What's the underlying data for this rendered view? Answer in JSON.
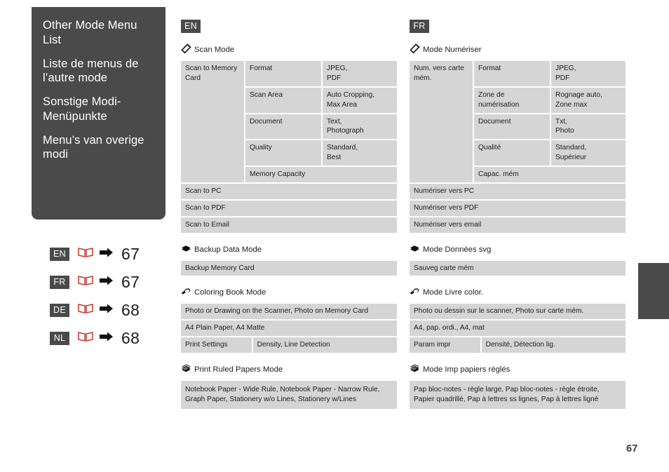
{
  "sidebar": {
    "titles": [
      "Other Mode Menu List",
      "Liste de menus de l’autre mode",
      "Sonstige Modi-Menüpunkte",
      "Menu’s van overige modi"
    ]
  },
  "language_index": {
    "rows": [
      {
        "code": "EN",
        "book_icon": "open-book-icon",
        "arrow_icon": "arrow-right-icon",
        "page": "67"
      },
      {
        "code": "FR",
        "book_icon": "open-book-icon",
        "arrow_icon": "arrow-right-icon",
        "page": "67"
      },
      {
        "code": "DE",
        "book_icon": "open-book-icon",
        "arrow_icon": "arrow-right-icon",
        "page": "68"
      },
      {
        "code": "NL",
        "book_icon": "open-book-icon",
        "arrow_icon": "arrow-right-icon",
        "page": "68"
      }
    ]
  },
  "en": {
    "tag": "EN",
    "scan_mode": {
      "icon": "scan-mode-icon",
      "title": "Scan Mode",
      "group_label": "Scan to Memory Card",
      "rows": [
        {
          "setting": "Format",
          "values": "JPEG,\nPDF"
        },
        {
          "setting": "Scan Area",
          "values": "Auto Cropping,\nMax Area"
        },
        {
          "setting": "Document",
          "values": "Text,\nPhotograph"
        },
        {
          "setting": "Quality",
          "values": "Standard,\nBest"
        },
        {
          "setting": "Memory Capacity",
          "values": ""
        }
      ],
      "items": [
        "Scan to PC",
        "Scan to PDF",
        "Scan to Email"
      ]
    },
    "backup_mode": {
      "icon": "backup-data-icon",
      "title": "Backup Data Mode",
      "items": [
        "Backup Memory Card"
      ]
    },
    "coloring_mode": {
      "icon": "coloring-book-icon",
      "title": "Coloring Book Mode",
      "items": [
        "Photo or Drawing on the Scanner, Photo on Memory Card",
        "A4 Plain Paper, A4 Matte"
      ],
      "setting_label": "Print Settings",
      "setting_values": "Density, Line Detection"
    },
    "ruled_mode": {
      "icon": "print-ruled-papers-icon",
      "title": "Print Ruled Papers Mode",
      "items": [
        "Notebook Paper - Wide Rule, Notebook Paper - Narrow Rule, Graph Paper, Stationery w/o Lines, Stationery w/Lines"
      ]
    }
  },
  "fr": {
    "tag": "FR",
    "scan_mode": {
      "icon": "scan-mode-icon",
      "title": "Mode Numériser",
      "group_label": "Num. vers carte mém.",
      "rows": [
        {
          "setting": "Format",
          "values": "JPEG,\nPDF"
        },
        {
          "setting": "Zone de numérisation",
          "values": "Rognage auto,\nZone max"
        },
        {
          "setting": "Document",
          "values": "Txt,\nPhoto"
        },
        {
          "setting": "Qualité",
          "values": "Standard,\nSupérieur"
        },
        {
          "setting": "Capac. mém",
          "values": ""
        }
      ],
      "items": [
        "Numériser vers PC",
        "Numériser vers PDF",
        "Numériser vers email"
      ]
    },
    "backup_mode": {
      "icon": "backup-data-icon",
      "title": "Mode Données svg",
      "items": [
        "Sauveg carte mém"
      ]
    },
    "coloring_mode": {
      "icon": "coloring-book-icon",
      "title": "Mode Livre color.",
      "items": [
        "Photo ou dessin sur le scanner, Photo sur carte mém.",
        "A4, pap. ordi., A4, mat"
      ],
      "setting_label": "Param impr",
      "setting_values": "Densité, Détection lig."
    },
    "ruled_mode": {
      "icon": "print-ruled-papers-icon",
      "title": "Mode Imp papiers réglés",
      "items": [
        "Pap bloc-notes - règle large, Pap bloc-notes - règle étroite, Papier quadrillé, Pap à lettres ss lignes, Pap à lettres ligné"
      ]
    }
  },
  "footer": {
    "page_number": "67"
  },
  "colors": {
    "dark": "#4a4a4a",
    "table_cell": "#d5d5d5",
    "book_red": "#c0392b",
    "text": "#1c1c1c"
  }
}
